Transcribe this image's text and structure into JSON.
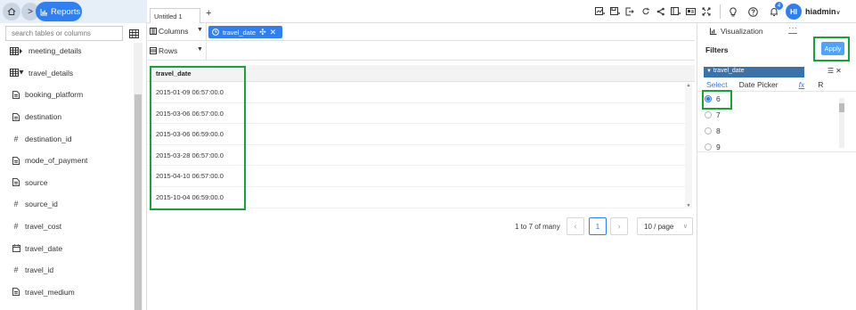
{
  "header": {
    "app_name": "Reports",
    "tab_title": "Untitled 1",
    "notification_count": "4",
    "avatar_initials": "HI",
    "user_name": "hiadmin"
  },
  "sidebar": {
    "search_placeholder": "search tables or columns",
    "items": [
      {
        "kind": "table",
        "label": "meeting_details"
      },
      {
        "kind": "table-open",
        "label": "travel_details"
      },
      {
        "kind": "text",
        "label": "booking_platform"
      },
      {
        "kind": "text",
        "label": "destination"
      },
      {
        "kind": "number",
        "label": "destination_id"
      },
      {
        "kind": "text",
        "label": "mode_of_payment"
      },
      {
        "kind": "text",
        "label": "source"
      },
      {
        "kind": "number",
        "label": "source_id"
      },
      {
        "kind": "number",
        "label": "travel_cost"
      },
      {
        "kind": "date",
        "label": "travel_date"
      },
      {
        "kind": "number",
        "label": "travel_id"
      },
      {
        "kind": "text",
        "label": "travel_medium"
      }
    ]
  },
  "shelves": {
    "columns_label": "Columns",
    "rows_label": "Rows",
    "column_chip": "travel_date"
  },
  "grid": {
    "header": "travel_date",
    "rows": [
      "2015-01-09 06:57:00.0",
      "2015-03-06 06:57:00.0",
      "2015-03-06 06:59:00.0",
      "2015-03-28 06:57:00.0",
      "2015-04-10 06:57:00.0",
      "2015-10-04 06:59:00.0"
    ]
  },
  "pagination": {
    "range_text": "1 to 7 of many",
    "current_page": "1",
    "per_page": "10 / page"
  },
  "right_panel": {
    "viz_tab": "Visualization",
    "more_tab": "···",
    "filters_title": "Filters",
    "apply_label": "Apply",
    "filter_field": "travel_date",
    "filter_tabs": [
      "Select",
      "Date Picker",
      "fx",
      "R"
    ],
    "options": [
      "6",
      "7",
      "8",
      "9"
    ],
    "selected_option": "6"
  },
  "colors": {
    "accent": "#2f7ff2",
    "highlight": "#18a337"
  }
}
